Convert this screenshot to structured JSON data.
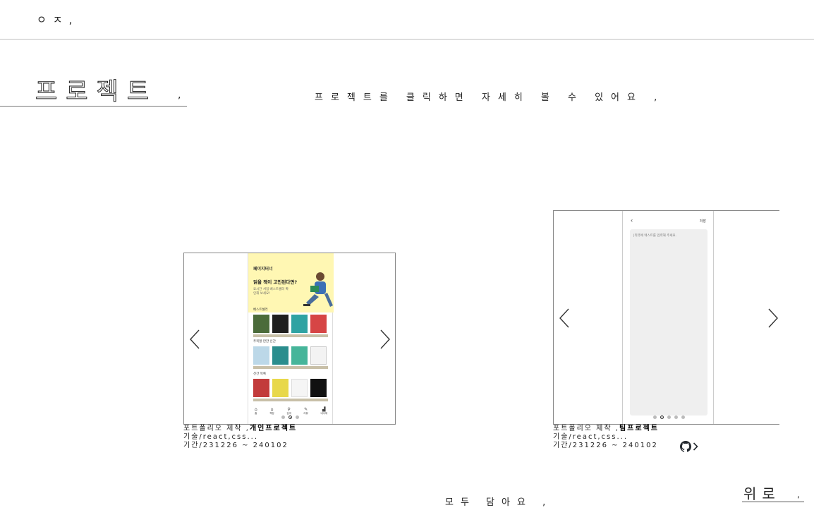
{
  "header": {
    "logo": "ㅇㅈ,"
  },
  "section": {
    "title": "프로젝트",
    "title_suffix": ",",
    "hint": "프로젝트를 클릭하면 자세히 볼 수 있어요 ,"
  },
  "projects": [
    {
      "type_prefix": "포트폴리오 제작 ,",
      "type": "개인프로젝트",
      "tech": "기술/react,css...",
      "period": "기간/231226 ~ 240102",
      "mockup": {
        "brand": "페이지터너",
        "headline": "읽을 책이 고민된다면?",
        "sub": "요시간 서점 베스트셀러 확인해 보세요!",
        "sections": [
          "베스트셀러",
          "주목할 만한 신간",
          "신간 목록"
        ],
        "nav": [
          "홈",
          "책장",
          "검색",
          "리뷰",
          "내서재"
        ]
      }
    },
    {
      "type_prefix": "포트폴리오 제작 ,",
      "type": "팀프로젝트",
      "tech": "기술/react,css...",
      "period": "기간/231226 ~ 240102",
      "mockup": {
        "back": "‹",
        "save": "저장",
        "placeholder": "|리뷰에 텍스트를 입력해 주세요."
      }
    }
  ],
  "footer": {
    "text": "모두 담아요 ,",
    "top_link": "위로",
    "top_link_suffix": ","
  },
  "colors": {
    "banner": "#fff7b3",
    "editor_bg": "#efefef",
    "border": "#888888"
  }
}
